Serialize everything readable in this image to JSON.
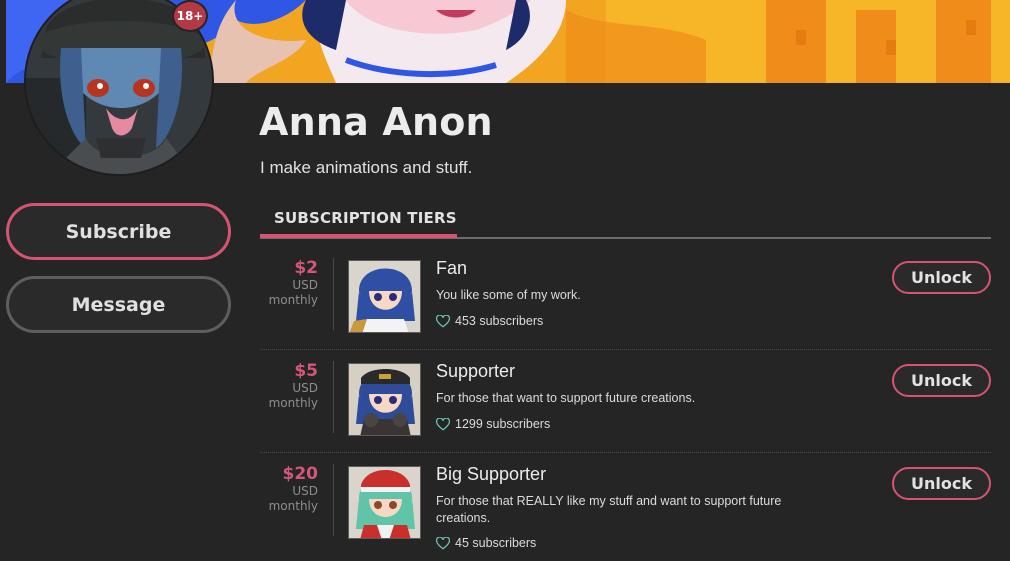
{
  "profile": {
    "name": "Anna Anon",
    "bio": "I make animations and stuff.",
    "age_badge": "18+"
  },
  "actions": {
    "subscribe_label": "Subscribe",
    "message_label": "Message"
  },
  "tiers_section": {
    "heading": "SUBSCRIPTION TIERS"
  },
  "tiers": [
    {
      "price": "$2",
      "currency": "USD",
      "period": "monthly",
      "name": "Fan",
      "description": "You like some of my work.",
      "subscribers": "453 subscribers",
      "unlock_label": "Unlock"
    },
    {
      "price": "$5",
      "currency": "USD",
      "period": "monthly",
      "name": "Supporter",
      "description": "For those that want to support future creations.",
      "subscribers": "1299 subscribers",
      "unlock_label": "Unlock"
    },
    {
      "price": "$20",
      "currency": "USD",
      "period": "monthly",
      "name": "Big Supporter",
      "description": "For those that REALLY like my stuff and want to support future creations.",
      "subscribers": "45 subscribers",
      "unlock_label": "Unlock"
    }
  ],
  "colors": {
    "accent": "#d45472",
    "background": "#252525",
    "banner_orange": "#f2a521",
    "banner_blue": "#2f57e6"
  },
  "icons": {
    "subscribers": "heart-outline-icon"
  }
}
